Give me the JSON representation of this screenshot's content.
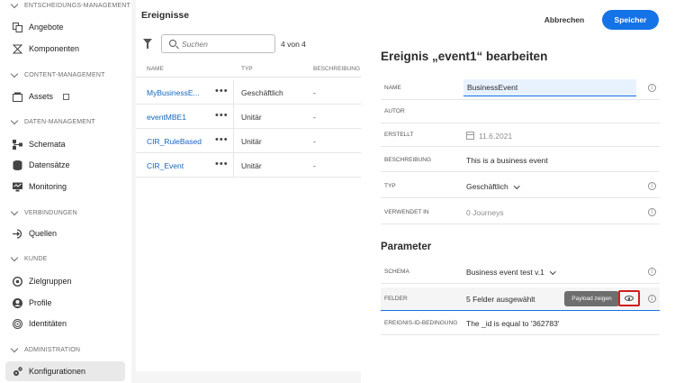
{
  "sidebar": {
    "sections": [
      {
        "label": "ENTSCHEIDUNGS-MANAGEMENT"
      },
      {
        "label": "CONTENT-MANAGEMENT"
      },
      {
        "label": "DATEN-MANAGEMENT"
      },
      {
        "label": "VERBINDUNGEN"
      },
      {
        "label": "KUNDE"
      },
      {
        "label": "ADMINISTRATION"
      }
    ],
    "items": [
      {
        "label": "Angebote",
        "icon": "offers-icon"
      },
      {
        "label": "Komponenten",
        "icon": "components-icon"
      },
      {
        "label": "Assets",
        "icon": "assets-icon"
      },
      {
        "label": "Schemata",
        "icon": "schema-icon"
      },
      {
        "label": "Datensätze",
        "icon": "datasets-icon"
      },
      {
        "label": "Monitoring",
        "icon": "monitoring-icon"
      },
      {
        "label": "Quellen",
        "icon": "sources-icon"
      },
      {
        "label": "Zielgruppen",
        "icon": "audiences-icon"
      },
      {
        "label": "Profile",
        "icon": "profile-icon"
      },
      {
        "label": "Identitäten",
        "icon": "identities-icon"
      },
      {
        "label": "Konfigurationen",
        "icon": "configurations-icon"
      }
    ]
  },
  "list": {
    "title": "Ereignisse",
    "search_placeholder": "Suchen",
    "count": "4 von 4",
    "columns": [
      "NAME",
      "TYP",
      "BESCHREIBUNG"
    ],
    "rows": [
      {
        "name": "MyBusinessE...",
        "type": "Geschäftlich",
        "desc": "-"
      },
      {
        "name": "eventMBE1",
        "type": "Unitär",
        "desc": "-"
      },
      {
        "name": "CIR_RuleBased",
        "type": "Unitär",
        "desc": "-"
      },
      {
        "name": "CIR_Event",
        "type": "Unitär",
        "desc": "-"
      }
    ],
    "more": "•••"
  },
  "panel": {
    "cancel": "Abbrechen",
    "save": "Speicher",
    "title": "Ereignis „event1“ bearbeiten",
    "fields": {
      "name_label": "NAME",
      "name_value": "BusinessEvent",
      "author_label": "AUTOR",
      "created_label": "ERSTELLT",
      "created_value": "11.6.2021",
      "desc_label": "BESCHREIBUNG",
      "desc_value": "This is a business event",
      "type_label": "TYP",
      "type_value": "Geschäftlich",
      "used_label": "VERWENDET IN",
      "used_value": "0 Journeys"
    },
    "params_title": "Parameter",
    "params": {
      "schema_label": "SCHEMA",
      "schema_value": "Business event test v.1",
      "fields_label": "FELDER",
      "fields_value": "5 Felder ausgewählt",
      "tooltip": "Payload zeigen",
      "condition_label": "EREIGNIS-ID-BEDINGUNG",
      "condition_value": "The _id is equal to '362783'"
    },
    "info_glyph": "i"
  }
}
